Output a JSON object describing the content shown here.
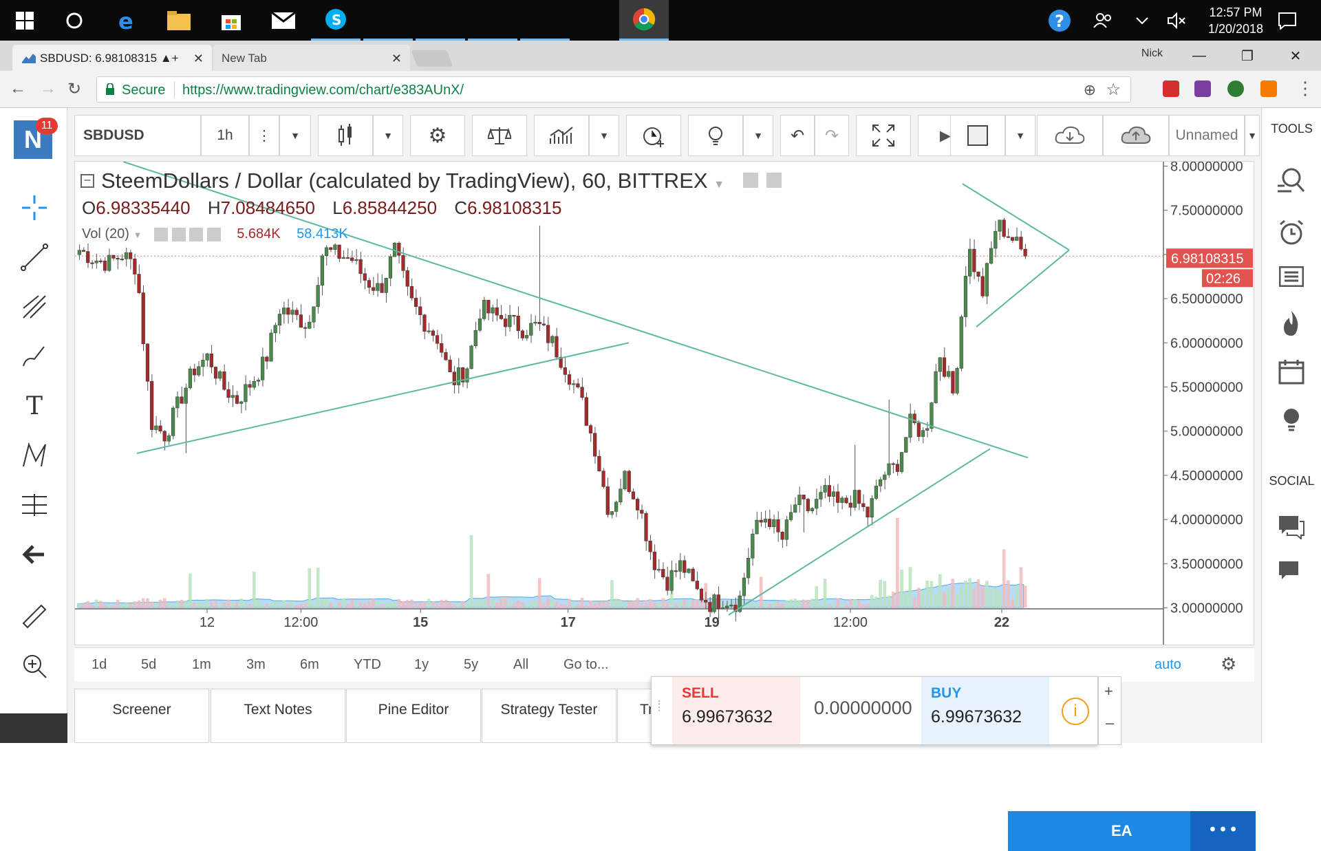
{
  "taskbar": {
    "time": "12:57 PM",
    "date": "1/20/2018"
  },
  "browser": {
    "tabs": [
      {
        "label": "SBDUSD: 6.98108315 ▲+"
      },
      {
        "label": "New Tab"
      }
    ],
    "profile": "Nick",
    "secure_label": "Secure",
    "url": "https://www.tradingview.com/chart/e383AUnX/"
  },
  "toolbar": {
    "symbol": "SBDUSD",
    "interval": "1h",
    "layout_name": "Unnamed"
  },
  "right_panel": {
    "tools_label": "TOOLS",
    "social_label": "SOCIAL"
  },
  "legend": {
    "title": "SteemDollars / Dollar (calculated by TradingView), 60, BITTREX",
    "open_label": "O",
    "open": "6.98335440",
    "high_label": "H",
    "high": "7.08484650",
    "low_label": "L",
    "low": "6.85844250",
    "close_label": "C",
    "close": "6.98108315",
    "vol_label": "Vol (20)",
    "vol_value": "5.684K",
    "vol_ma": "58.413K"
  },
  "price_badge": {
    "price": "6.98108315",
    "countdown": "02:26"
  },
  "ranges": [
    "1d",
    "5d",
    "1m",
    "3m",
    "6m",
    "YTD",
    "1y",
    "5y",
    "All",
    "Go to..."
  ],
  "scale_mode": "auto",
  "footer_tabs": [
    "Screener",
    "Text Notes",
    "Pine Editor",
    "Strategy Tester",
    "Trading Panel"
  ],
  "trade": {
    "sell_label": "SELL",
    "sell_price": "6.99673632",
    "spread": "0.00000000",
    "buy_label": "BUY",
    "buy_price": "6.99673632"
  },
  "publish_label": "EA",
  "chart_data": {
    "type": "candlestick",
    "y_ticks": [
      "8.00000000",
      "7.50000000",
      "7.00000000",
      "6.50000000",
      "6.00000000",
      "5.50000000",
      "5.00000000",
      "4.50000000",
      "4.00000000",
      "3.50000000",
      "3.00000000"
    ],
    "x_ticks": [
      "12",
      "12:00",
      "15",
      "17",
      "19",
      "12:00",
      "22"
    ],
    "ylim": [
      2.6,
      8.05
    ],
    "ohlc_path": [
      7.05,
      6.95,
      6.9,
      7.0,
      6.85,
      5.1,
      4.95,
      5.35,
      5.7,
      5.85,
      5.5,
      5.35,
      5.55,
      5.8,
      6.4,
      6.3,
      6.2,
      7.05,
      7.0,
      6.95,
      6.7,
      6.6,
      7.05,
      6.5,
      6.25,
      6.05,
      5.55,
      5.7,
      6.4,
      6.3,
      6.25,
      6.15,
      6.2,
      6.0,
      5.7,
      5.35,
      4.8,
      4.05,
      4.5,
      4.2,
      3.55,
      3.3,
      3.5,
      3.2,
      3.05,
      3.1,
      3.05,
      3.85,
      4.05,
      3.75,
      4.2,
      4.1,
      4.3,
      4.15,
      4.25,
      4.05,
      4.5,
      4.6,
      5.1,
      4.95,
      5.9,
      5.4,
      7.1,
      6.55,
      7.35,
      7.2,
      6.98
    ],
    "volume": "low baseline with spikes near the 15th and during the rally on the 19th–20th",
    "last_price": "6.98108315",
    "drawings": [
      "descending trendline",
      "ascending trendline",
      "symmetrical triangle",
      "support trendline"
    ]
  }
}
